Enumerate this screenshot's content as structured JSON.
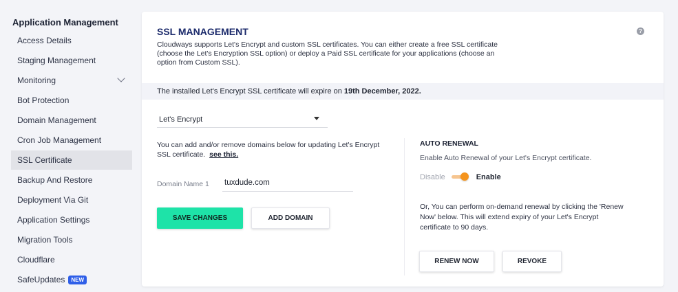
{
  "sidebar": {
    "heading": "Application Management",
    "items": [
      {
        "label": "Access Details"
      },
      {
        "label": "Staging Management"
      },
      {
        "label": "Monitoring"
      },
      {
        "label": "Bot Protection"
      },
      {
        "label": "Domain Management"
      },
      {
        "label": "Cron Job Management"
      },
      {
        "label": "SSL Certificate"
      },
      {
        "label": "Backup And Restore"
      },
      {
        "label": "Deployment Via Git"
      },
      {
        "label": "Application Settings"
      },
      {
        "label": "Migration Tools"
      },
      {
        "label": "Cloudflare"
      },
      {
        "label": "SafeUpdates",
        "badge": "NEW"
      }
    ],
    "active_item": "SSL Certificate"
  },
  "ssl": {
    "title": "SSL MANAGEMENT",
    "description": "Cloudways supports Let's Encrypt and custom SSL certificates. You can either create a free SSL certificate (choose the Let's Encryption SSL option) or deploy a Paid SSL certificate for your applications (choose an option from Custom SSL).",
    "notice_prefix": "The installed Let's Encrypt SSL certificate will expire on",
    "notice_date": "19th December, 2022.",
    "select_value": "Let's Encrypt",
    "domains_text": "You can add and/or remove domains below for updating Let's Encrypt SSL certificate.",
    "see_link": "see this.",
    "domain_label": "Domain Name 1",
    "domain_value": "tuxdude.com",
    "save_button": "SAVE CHANGES",
    "add_domain_button": "ADD DOMAIN"
  },
  "auto_renewal": {
    "title": "AUTO RENEWAL",
    "description": "Enable Auto Renewal of your Let's Encrypt certificate.",
    "disable_label": "Disable",
    "enable_label": "Enable",
    "enabled": true,
    "renew_text": "Or, You can perform on-demand renewal by clicking the 'Renew Now' below. This will extend expiry of your Let's Encrypt certificate to 90 days.",
    "renew_button": "RENEW NOW",
    "revoke_button": "REVOKE"
  },
  "colors": {
    "accent_green": "#1ee3a8",
    "toggle_orange": "#f5941d",
    "title_navy": "#1b2a6b",
    "badge_blue": "#2f5fe8"
  }
}
